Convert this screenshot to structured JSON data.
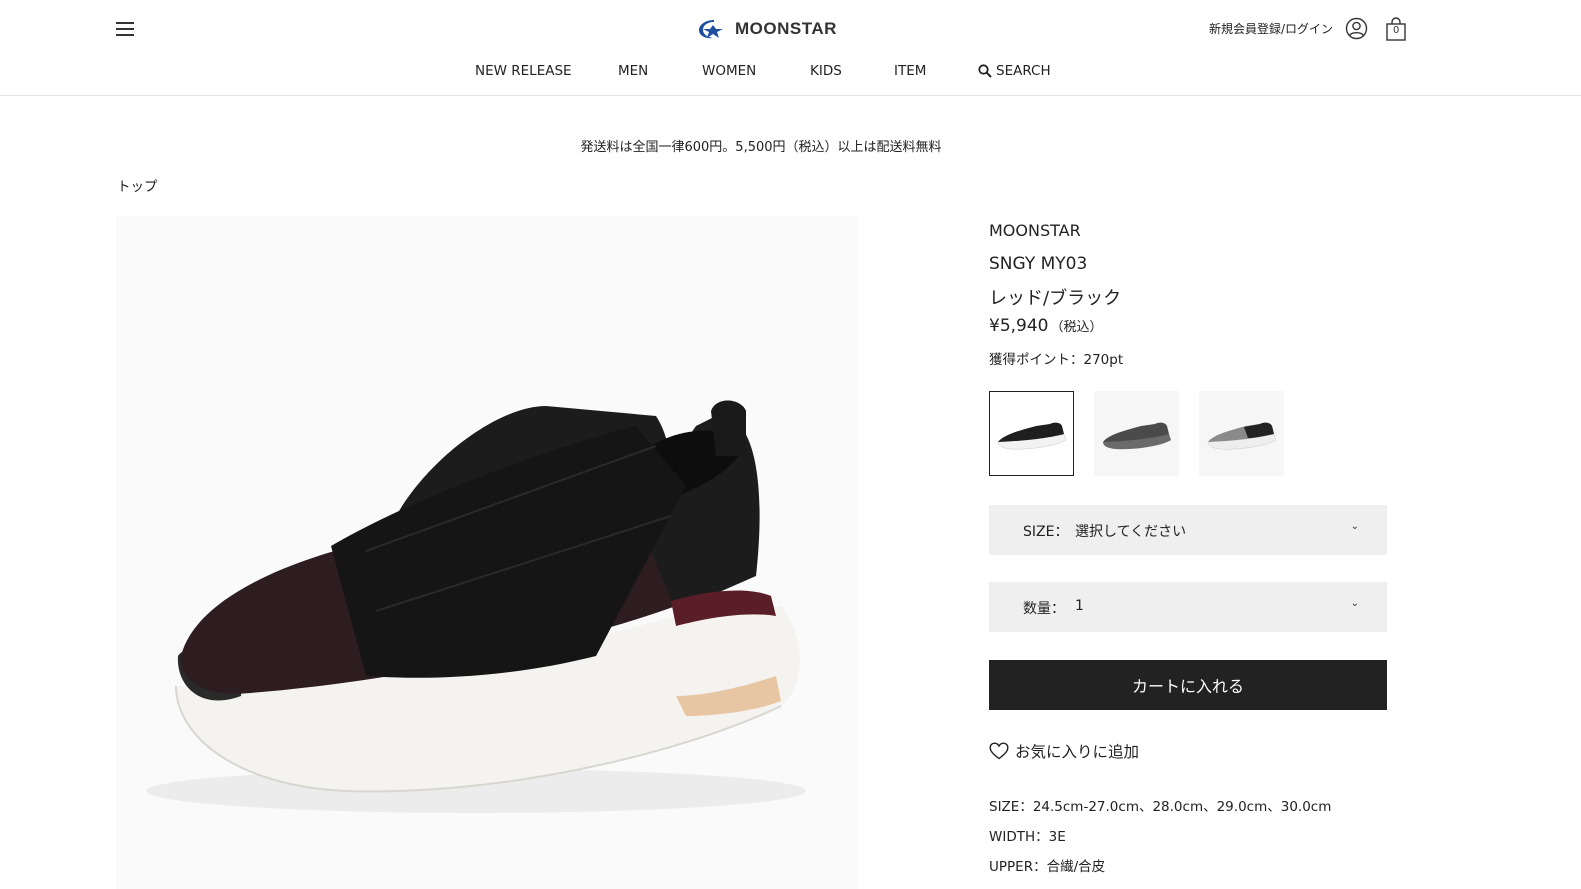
{
  "header": {
    "logo_text": "MOONSTAR",
    "login_link": "新規会員登録/ログイン",
    "cart_count": "0"
  },
  "nav": {
    "items": [
      "NEW RELEASE",
      "MEN",
      "WOMEN",
      "KIDS",
      "ITEM"
    ],
    "search_label": "SEARCH"
  },
  "notice": {
    "shipping": "発送料は全国一律600円。5,500円（税込）以上は配送料無料"
  },
  "breadcrumb": {
    "top": "トップ"
  },
  "product": {
    "brand": "MOONSTAR",
    "model": "SNGY MY03",
    "color": "レッド/ブラック",
    "price": "¥5,940",
    "price_tax": "（税込）",
    "points": "獲得ポイント：270pt",
    "swatches": [
      {
        "name": "black-red",
        "color": "#1e1e1e",
        "selected": true
      },
      {
        "name": "dark-gray",
        "color": "#4a4a4a",
        "selected": false
      },
      {
        "name": "gray-black",
        "color": "#8a8a8a",
        "selected": false
      }
    ],
    "size_label": "SIZE：",
    "size_value": "選択してください",
    "qty_label": "数量：",
    "qty_value": "1",
    "add_to_cart": "カートに入れる",
    "favorite": "お気に入りに追加",
    "specs": [
      "SIZE：24.5cm-27.0cm、28.0cm、29.0cm、30.0cm",
      "WIDTH：3E",
      "UPPER：合繊/合皮"
    ]
  },
  "colors": {
    "accent": "#222222",
    "logo_blue": "#1f4fa0",
    "select_bg": "#efefef"
  }
}
